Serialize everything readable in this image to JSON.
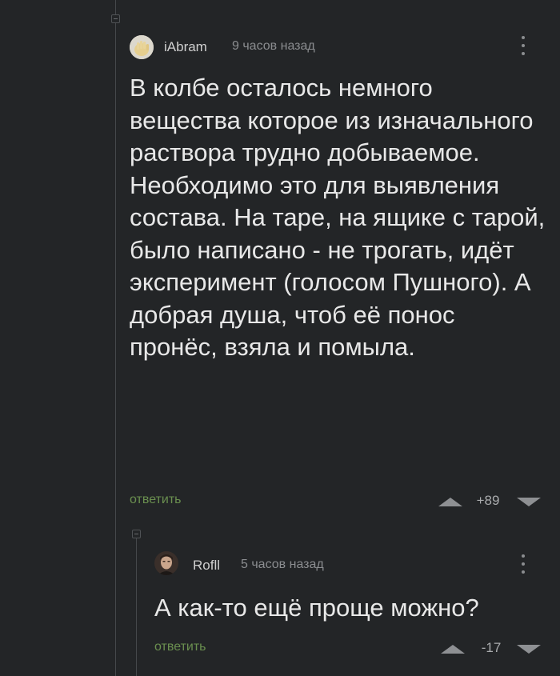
{
  "comments": [
    {
      "author": "iAbram",
      "time": "9 часов назад",
      "text": "В колбе осталось немного вещества которое из изначального раствора трудно добываемое. Необходимо это для выявления состава. На таре, на ящике с тарой, было написано - не трогать, идёт эксперимент (голосом Пушного). А добрая душа, чтоб её понос пронёс, взяла и помыла.",
      "reply_label": "ответить",
      "rating": "+89",
      "avatar_icon": "avatar-hand-icon"
    },
    {
      "author": "Rofll",
      "time": "5 часов назад",
      "text": "А как-то ещё проще можно?",
      "reply_label": "ответить",
      "rating": "-17",
      "avatar_icon": "avatar-portrait-icon"
    }
  ],
  "colors": {
    "background": "#232527",
    "text": "#e8e8e8",
    "reply_link": "#6a8f4f",
    "meta": "#8b8d90"
  }
}
